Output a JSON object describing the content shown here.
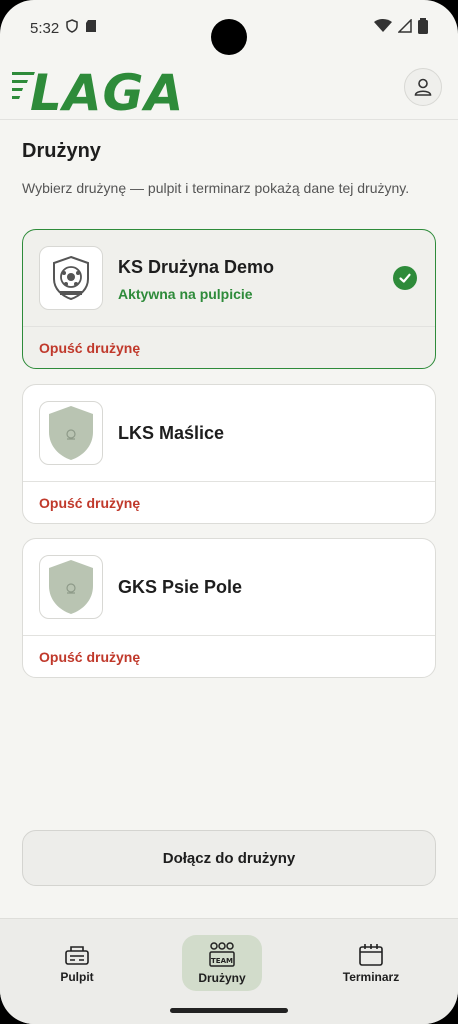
{
  "status_bar": {
    "time": "5:32"
  },
  "app": {
    "logo_text": "LAGA"
  },
  "page": {
    "title": "Drużyny",
    "subtitle": "Wybierz drużynę — pulpit i terminarz pokażą dane tej drużyny."
  },
  "teams": [
    {
      "name": "KS Drużyna Demo",
      "status": "Aktywna na pulpicie",
      "leave_label": "Opuść drużynę",
      "active": true
    },
    {
      "name": "LKS Maślice",
      "leave_label": "Opuść drużynę",
      "active": false
    },
    {
      "name": "GKS Psie Pole",
      "leave_label": "Opuść drużynę",
      "active": false
    }
  ],
  "join_button": {
    "label": "Dołącz do drużyny"
  },
  "nav": {
    "items": [
      {
        "label": "Pulpit",
        "icon": "dashboard-icon",
        "active": false
      },
      {
        "label": "Drużyny",
        "icon": "team-icon",
        "icon_text": "TEAM",
        "active": true
      },
      {
        "label": "Terminarz",
        "icon": "calendar-icon",
        "active": false
      }
    ]
  },
  "colors": {
    "accent": "#2e8b3a",
    "danger": "#c0392b",
    "active_nav_bg": "#d2dccb"
  }
}
